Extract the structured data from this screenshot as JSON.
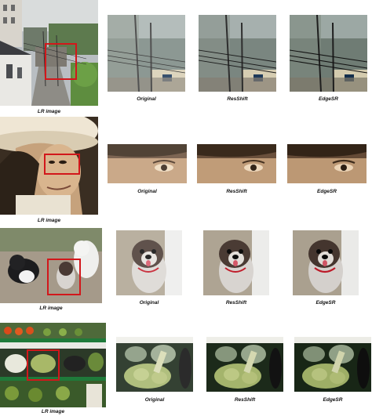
{
  "figure": {
    "rows": [
      {
        "scene": "alley",
        "lr_label": "LR image",
        "labels": [
          "Original",
          "ResShift",
          "EdgeSR"
        ]
      },
      {
        "scene": "portrait",
        "lr_label": "LR image",
        "labels": [
          "Original",
          "ResShift",
          "EdgeSR"
        ]
      },
      {
        "scene": "dogs",
        "lr_label": "LR image",
        "labels": [
          "Original",
          "ResShift",
          "EdgeSR"
        ]
      },
      {
        "scene": "vegetables",
        "lr_label": "LR image",
        "labels": [
          "Original",
          "ResShift",
          "EdgeSR"
        ]
      }
    ],
    "highlight_color": "#d2171b"
  }
}
